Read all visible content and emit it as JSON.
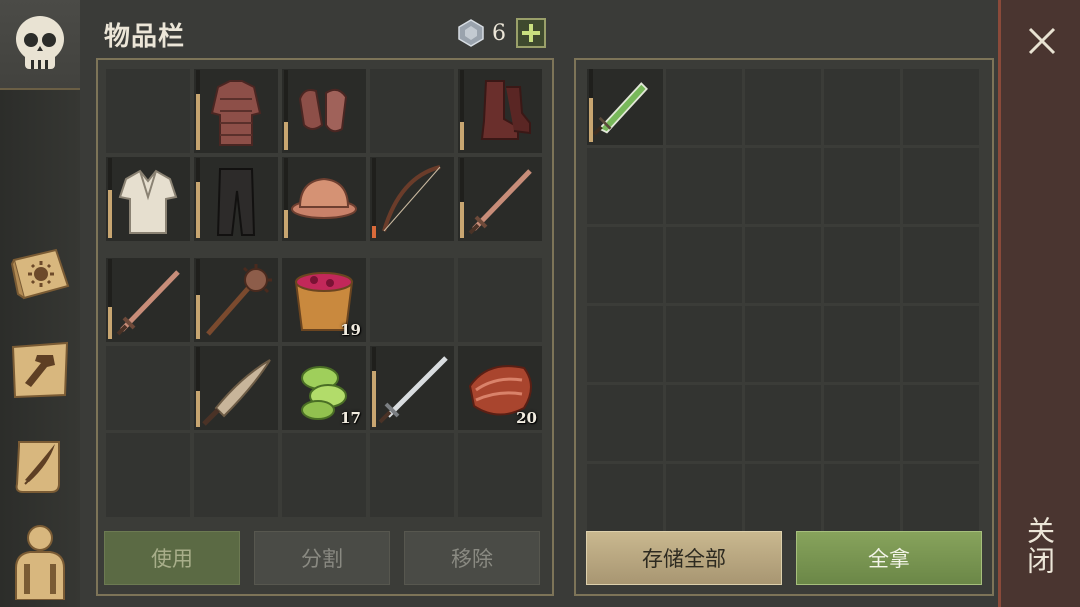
{
  "header": {
    "title": "物品栏",
    "currency_value": "6"
  },
  "inventory": {
    "rows": [
      [
        {
          "item": "",
          "count": "",
          "durability": null
        },
        {
          "item": "chainmail-armor",
          "count": "",
          "durability": 0.7
        },
        {
          "item": "chainmail-gloves",
          "count": "",
          "durability": 0.35
        },
        {
          "item": "",
          "count": "",
          "durability": null
        },
        {
          "item": "leather-boots",
          "count": "",
          "durability": 0.35
        }
      ],
      [
        {
          "item": "linen-shirt",
          "count": "",
          "durability": 0.6
        },
        {
          "item": "trousers",
          "count": "",
          "durability": 0.7
        },
        {
          "item": "copper-helmet",
          "count": "",
          "durability": 0.35
        },
        {
          "item": "bow",
          "count": "",
          "durability": 0.15
        },
        {
          "item": "copper-sword",
          "count": "",
          "durability": 0.45
        }
      ],
      [
        {
          "item": "copper-sword",
          "count": "",
          "durability": 0.4
        },
        {
          "item": "spiked-mace",
          "count": "",
          "durability": 0.55
        },
        {
          "item": "berry-bucket",
          "count": "19",
          "durability": null
        },
        {
          "item": "",
          "count": "",
          "durability": null
        },
        {
          "item": "",
          "count": "",
          "durability": null
        }
      ],
      [
        {
          "item": "",
          "count": "",
          "durability": null
        },
        {
          "item": "machete",
          "count": "",
          "durability": 0.45
        },
        {
          "item": "cactus-pieces",
          "count": "17",
          "durability": null
        },
        {
          "item": "iron-sword",
          "count": "",
          "durability": 0.7
        },
        {
          "item": "raw-meat",
          "count": "20",
          "durability": null
        }
      ],
      [
        {
          "item": "",
          "count": "",
          "durability": null
        },
        {
          "item": "",
          "count": "",
          "durability": null
        },
        {
          "item": "",
          "count": "",
          "durability": null
        },
        {
          "item": "",
          "count": "",
          "durability": null
        },
        {
          "item": "",
          "count": "",
          "durability": null
        }
      ]
    ]
  },
  "storage": {
    "first_item": {
      "item": "green-dagger",
      "count": "",
      "durability": 0.55
    }
  },
  "buttons": {
    "use": "使用",
    "split": "分割",
    "remove": "移除",
    "store_all": "存储全部",
    "take_all": "全拿"
  },
  "close_label": "关闭",
  "colors": {
    "accent_green": "#87a35c",
    "accent_tan": "#c9b88f",
    "close_bar": "#4a3530",
    "durability": "#c8a671",
    "durability_low": "#d96a3a"
  }
}
